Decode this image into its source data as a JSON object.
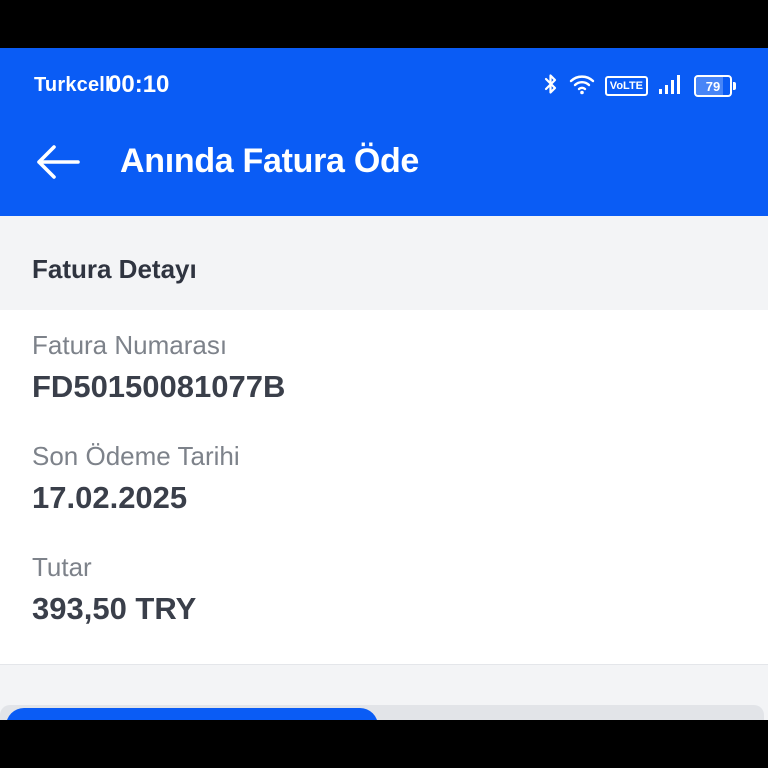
{
  "status_bar": {
    "carrier": "Turkcell",
    "time": "00:10",
    "volte": "VoLTE",
    "battery": 79,
    "icons": [
      "bluetooth-icon",
      "wifi-icon",
      "volte-icon",
      "signal-icon",
      "battery-icon"
    ]
  },
  "header": {
    "title": "Anında Fatura Öde",
    "back_icon": "arrow-left-icon"
  },
  "section": {
    "title": "Fatura Detayı"
  },
  "fields": [
    {
      "label": "Fatura Numarası",
      "value": "FD50150081077B"
    },
    {
      "label": "Son Ödeme Tarihi",
      "value": "17.02.2025"
    },
    {
      "label": "Tutar",
      "value": "393,50 TRY"
    }
  ],
  "colors": {
    "brand": "#0a5cf5",
    "page_bg": "#f3f4f6",
    "card_bg": "#ffffff",
    "label": "#7d828a",
    "value": "#3a3f4a"
  }
}
